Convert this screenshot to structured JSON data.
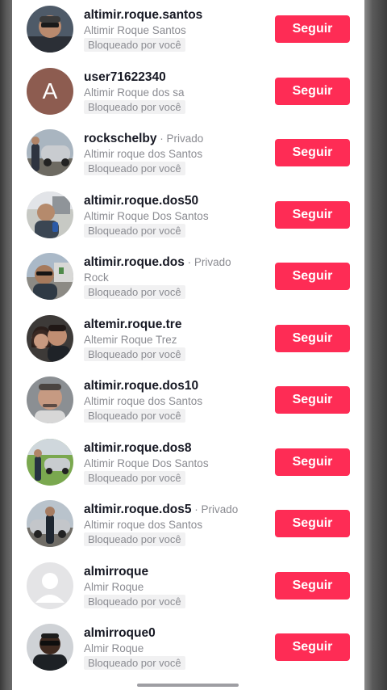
{
  "rows": [
    {
      "username": "altimir.roque.santos",
      "private": "",
      "fullname": "Altimir Roque Santos",
      "blocked": "Bloqueado por você",
      "button": "Seguir",
      "avatar": "photo-man-sunglasses"
    },
    {
      "username": "user71622340",
      "private": "",
      "fullname": "Altimir Roque dos sa",
      "blocked": "Bloqueado por você",
      "button": "Seguir",
      "avatar": "letter",
      "letter": "A"
    },
    {
      "username": "rockschelby",
      "private": " · Privado",
      "fullname": "Altimir roque dos Santos",
      "blocked": "Bloqueado por você",
      "button": "Seguir",
      "avatar": "photo-car"
    },
    {
      "username": "altimir.roque.dos50",
      "private": "",
      "fullname": "Altimir Roque Dos Santos",
      "blocked": "Bloqueado por você",
      "button": "Seguir",
      "avatar": "photo-man-outdoor"
    },
    {
      "username": "altimir.roque.dos",
      "private": " · Privado",
      "fullname": "Rock",
      "blocked": "Bloqueado por você",
      "button": "Seguir",
      "avatar": "photo-man-street"
    },
    {
      "username": "altemir.roque.tre",
      "private": "",
      "fullname": "Altemir Roque Trez",
      "blocked": "Bloqueado por você",
      "button": "Seguir",
      "avatar": "photo-couple"
    },
    {
      "username": "altimir.roque.dos10",
      "private": "",
      "fullname": "Altimir roque dos Santos",
      "blocked": "Bloqueado por você",
      "button": "Seguir",
      "avatar": "photo-man-face"
    },
    {
      "username": "altimir.roque.dos8",
      "private": "",
      "fullname": "Altimir Roque Dos Santos",
      "blocked": "Bloqueado por você",
      "button": "Seguir",
      "avatar": "photo-car-field"
    },
    {
      "username": "altimir.roque.dos5",
      "private": " · Privado",
      "fullname": "Altimir roque dos Santos",
      "blocked": "Bloqueado por você",
      "button": "Seguir",
      "avatar": "photo-man-car"
    },
    {
      "username": "almirroque",
      "private": "",
      "fullname": "Almir Roque",
      "blocked": "Bloqueado por você",
      "button": "Seguir",
      "avatar": "default-person"
    },
    {
      "username": "almirroque0",
      "private": "",
      "fullname": "Almir Roque",
      "blocked": "Bloqueado por você",
      "button": "Seguir",
      "avatar": "photo-man-dark"
    }
  ],
  "colors": {
    "accent": "#fe2c55",
    "secondary_text": "#8a8b91",
    "primary_text": "#161823",
    "badge_bg": "#f1f1f2"
  }
}
